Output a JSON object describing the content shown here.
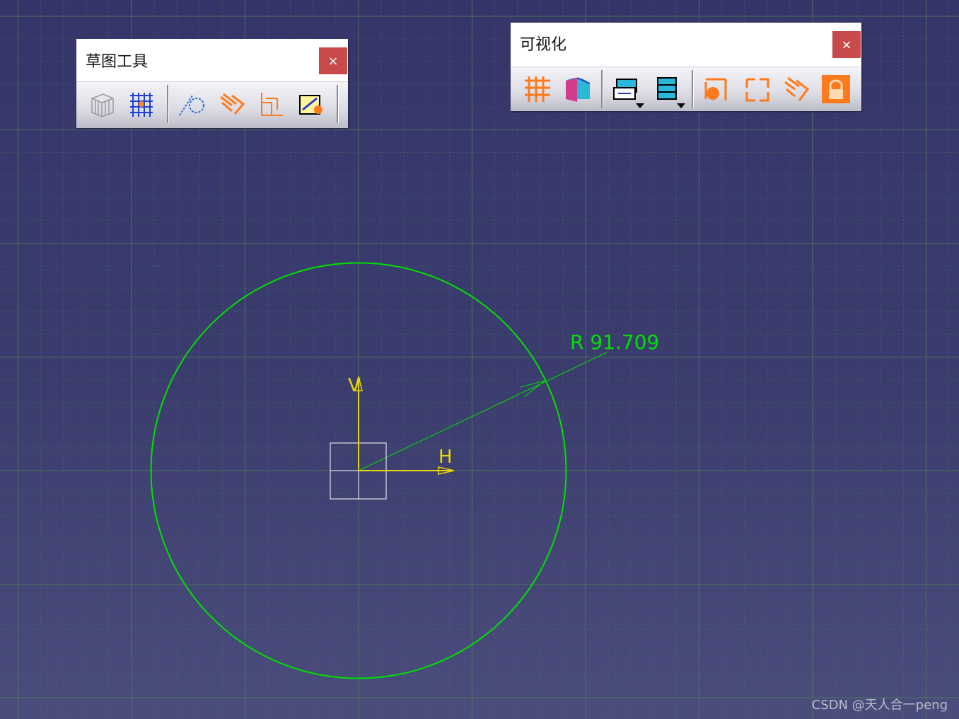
{
  "canvas": {
    "background": "#3b3d6e",
    "grid_color": "#4f7a5a",
    "geometry_color": "#00e000",
    "axis_color": "#e8d800"
  },
  "sketch": {
    "dimension_label": "R 91.709",
    "h_axis_label": "H",
    "v_axis_label": "V"
  },
  "toolbars": {
    "sketch_tools": {
      "title": "草图工具",
      "close_label": "×",
      "buttons": [
        {
          "name": "3d-grid-icon"
        },
        {
          "name": "snap-to-point-icon"
        },
        {
          "name": "construction-element-icon"
        },
        {
          "name": "geometric-constraints-icon"
        },
        {
          "name": "dimensional-constraints-icon"
        },
        {
          "name": "automatic-constraints-icon"
        }
      ]
    },
    "visualization": {
      "title": "可视化",
      "close_label": "×",
      "buttons": [
        {
          "name": "grid-icon"
        },
        {
          "name": "cut-part-by-sketch-plane-icon"
        },
        {
          "name": "sketch-visualization-mode-icon"
        },
        {
          "name": "diagnosis-icon"
        },
        {
          "name": "dimensional-constraints-visibility-icon"
        },
        {
          "name": "geometric-constraints-visibility-icon"
        },
        {
          "name": "constraint-display-icon"
        },
        {
          "name": "lock-visualization-icon"
        }
      ]
    }
  },
  "watermark": "CSDN @天人合一peng",
  "accent_colors": {
    "close_button": "#c94a4a",
    "icon_orange": "#ff7a1a",
    "icon_blue": "#1f3fd6",
    "icon_cyan": "#2bb7d8"
  }
}
